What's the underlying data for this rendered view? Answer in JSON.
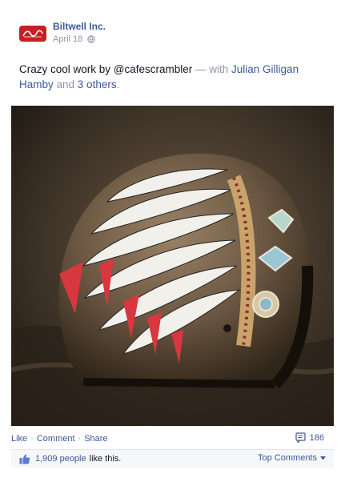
{
  "post": {
    "page_name": "Biltwell Inc.",
    "logo_text": "Biltwell Inc",
    "date": "April 18",
    "text_prefix": "Crazy cool work by @cafescrambler",
    "text_dash": " — with ",
    "tag_person": "Julian Gilligan Hamby",
    "text_and": " and ",
    "tag_others": "3 others",
    "text_suffix": "."
  },
  "actions": {
    "like": "Like",
    "comment": "Comment",
    "share": "Share",
    "separator": "·",
    "comment_count": "186"
  },
  "likes": {
    "count": "1,909 people",
    "suffix": "like this.",
    "top_comments": "Top Comments"
  },
  "icons": {
    "privacy": "globe-icon",
    "comments": "comment-bubble-icon",
    "like": "thumbs-up-icon",
    "dropdown": "caret-down-icon"
  },
  "colors": {
    "link": "#3b5998",
    "muted": "#9197a3",
    "brand": "#c62024"
  }
}
